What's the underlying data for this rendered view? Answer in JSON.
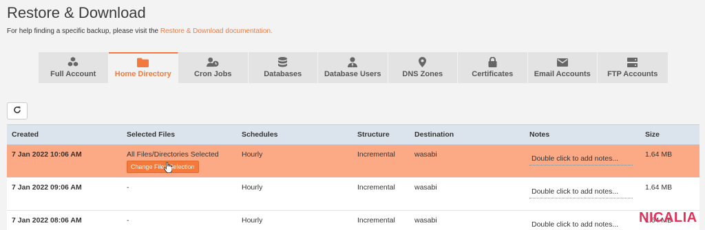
{
  "page": {
    "title": "Restore & Download",
    "help_prefix": "For help finding a specific backup, please visit the ",
    "help_link": "Restore & Download documentation."
  },
  "tabs": [
    {
      "label": "Full Account",
      "icon": "cubes-icon"
    },
    {
      "label": "Home Directory",
      "icon": "folder-icon",
      "active": true
    },
    {
      "label": "Cron Jobs",
      "icon": "user-clock-icon"
    },
    {
      "label": "Databases",
      "icon": "database-icon"
    },
    {
      "label": "Database Users",
      "icon": "user-tie-icon"
    },
    {
      "label": "DNS Zones",
      "icon": "map-marker-icon"
    },
    {
      "label": "Certificates",
      "icon": "lock-icon"
    },
    {
      "label": "Email Accounts",
      "icon": "envelope-icon"
    },
    {
      "label": "FTP Accounts",
      "icon": "server-icon"
    }
  ],
  "table": {
    "headers": [
      "Created",
      "Selected Files",
      "Schedules",
      "Structure",
      "Destination",
      "Notes",
      "Size"
    ],
    "rows": [
      {
        "created": "7 Jan 2022 10:06 AM",
        "files": "All Files/Directories Selected",
        "button": "Change Files Selection",
        "schedule": "Hourly",
        "structure": "Incremental",
        "destination": "wasabi",
        "notes": "Double click to add notes...",
        "size": "1.64 MB"
      },
      {
        "created": "7 Jan 2022 09:06 AM",
        "files": "-",
        "schedule": "Hourly",
        "structure": "Incremental",
        "destination": "wasabi",
        "notes": "Double click to add notes...",
        "size": "1.64 MB"
      },
      {
        "created": "7 Jan 2022 08:06 AM",
        "files": "-",
        "schedule": "Hourly",
        "structure": "Incremental",
        "destination": "wasabi",
        "notes": "Double click to add notes...",
        "size": "1.64 MB"
      }
    ]
  },
  "logo": {
    "text": "NICALIA"
  },
  "colors": {
    "accent": "#f37a3c",
    "selected_row": "#fca986",
    "header_bg": "#dbe3ec",
    "logo": "#e3315a"
  }
}
